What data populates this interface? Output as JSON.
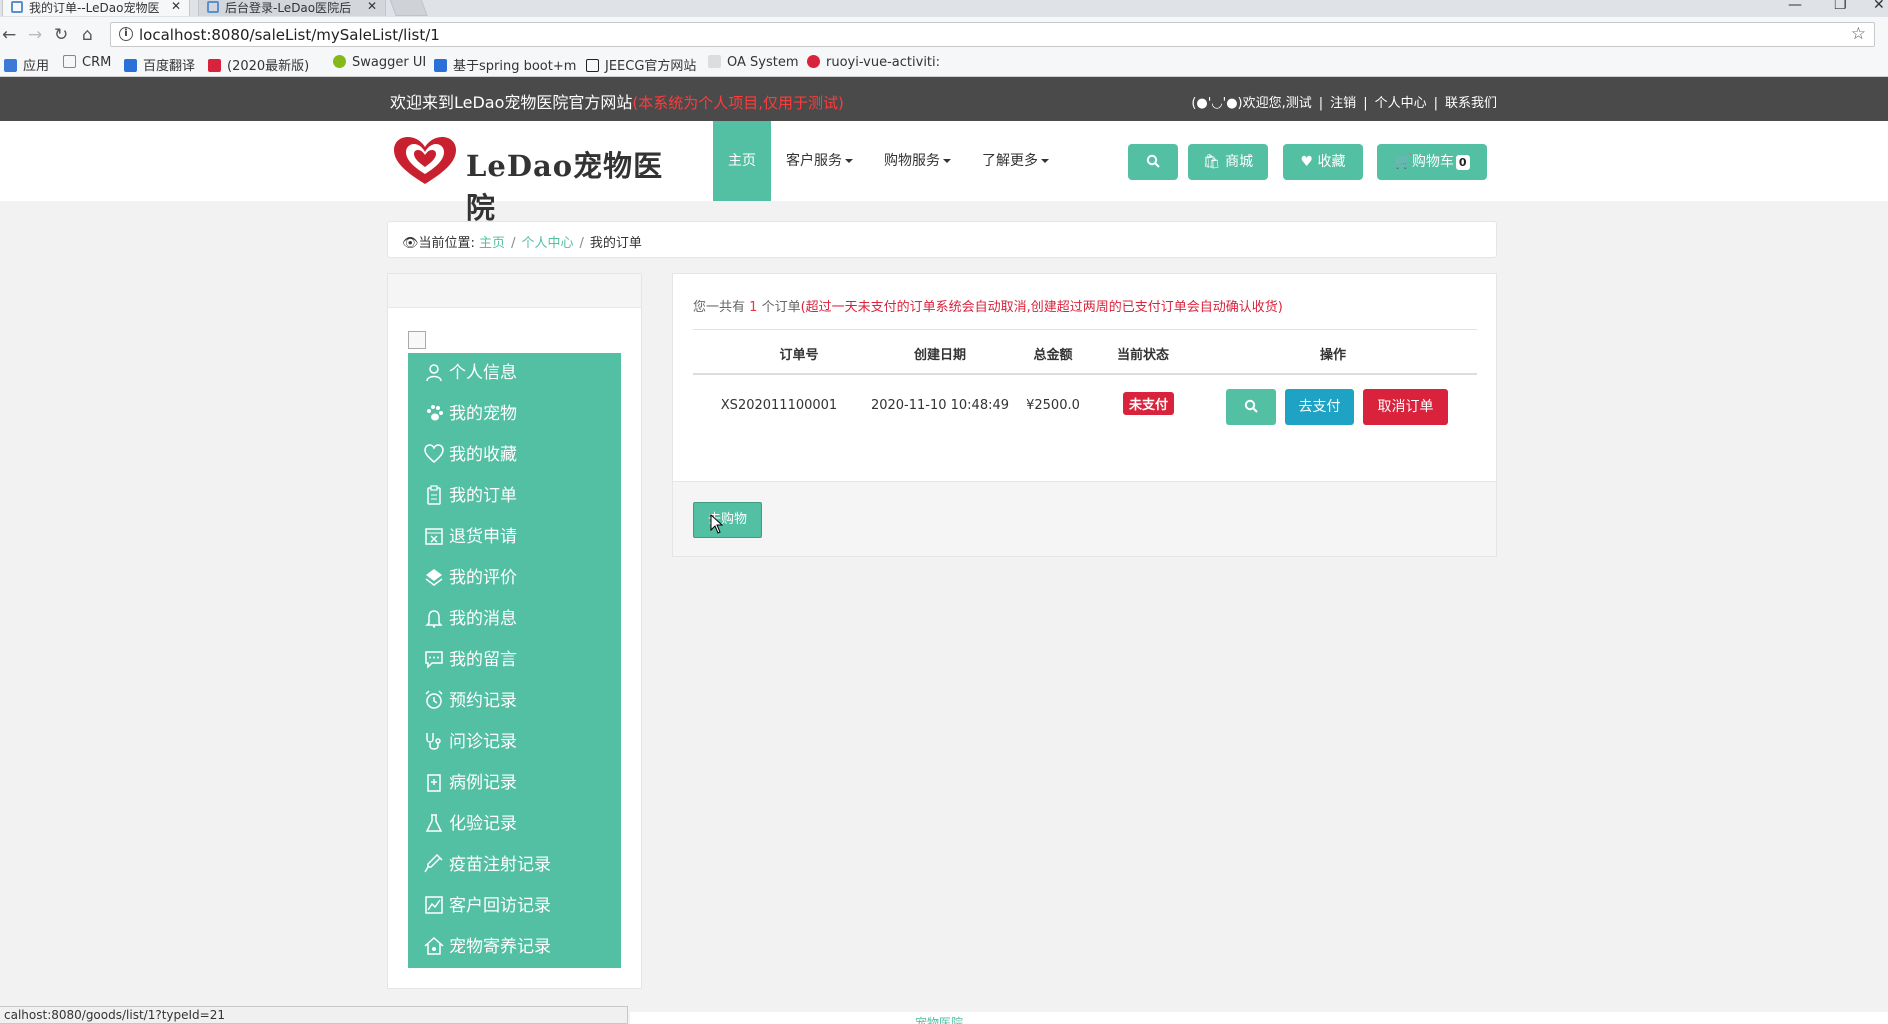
{
  "browser": {
    "tabs": [
      {
        "title": "我的订单--LeDao宠物医"
      },
      {
        "title": "后台登录-LeDao医院后"
      }
    ],
    "url": "localhost:8080/saleList/mySaleList/list/1",
    "bookmarks": [
      {
        "label": "应用",
        "icon": "apps-icon",
        "color": "#3c78d8"
      },
      {
        "label": "CRM",
        "icon": "page-icon",
        "color": "#888888"
      },
      {
        "label": "百度翻译",
        "icon": "baidu-translate-icon",
        "color": "#2b6fd9"
      },
      {
        "label": "(2020最新版)",
        "icon": "csdn-icon",
        "color": "#d9233c"
      },
      {
        "label": "Swagger UI",
        "icon": "swagger-icon",
        "color": "#85b81b"
      },
      {
        "label": "基于spring boot+m",
        "icon": "doc-icon",
        "color": "#2b6fd9"
      },
      {
        "label": "JEECG官方网站",
        "icon": "jeecg-icon",
        "color": "#222222"
      },
      {
        "label": "OA System",
        "icon": "oa-icon",
        "color": "#bbbbbb"
      },
      {
        "label": "ruoyi-vue-activiti: ",
        "icon": "gitee-icon",
        "color": "#d9233c"
      }
    ],
    "status_url": "calhost:8080/goods/list/1?typeId=21"
  },
  "site": {
    "welcome": "欢迎来到LeDao宠物医院官方网站",
    "welcome_note": "(本系统为个人项目,仅用于测试)",
    "top_links": {
      "greeting": "(●'◡'●)欢迎您,测试",
      "logout": "注销",
      "user_center": "个人中心",
      "contact": "联系我们"
    },
    "logo_text": "LeDao宠物医院",
    "nav": {
      "home": "主页",
      "customer": "客户服务",
      "shopping": "购物服务",
      "more": "了解更多"
    },
    "buttons": {
      "mall": "商城",
      "favorite": "收藏",
      "cart": "购物车",
      "cart_count": "0"
    },
    "brand_color": "#53bfa3",
    "danger_color": "#d9233c",
    "info_color": "#1ea3c4"
  },
  "breadcrumb": {
    "prefix": "当前位置:",
    "home": "主页",
    "user_center": "个人中心",
    "current": "我的订单"
  },
  "sidebar": {
    "items": [
      {
        "label": "个人信息",
        "icon": "user-icon"
      },
      {
        "label": "我的宠物",
        "icon": "paw-icon"
      },
      {
        "label": "我的收藏",
        "icon": "heart-icon"
      },
      {
        "label": "我的订单",
        "icon": "clipboard-icon"
      },
      {
        "label": "退货申请",
        "icon": "return-box-icon"
      },
      {
        "label": "我的评价",
        "icon": "review-icon"
      },
      {
        "label": "我的消息",
        "icon": "bell-icon"
      },
      {
        "label": "我的留言",
        "icon": "chat-icon"
      },
      {
        "label": "预约记录",
        "icon": "alarm-clock-icon"
      },
      {
        "label": "问诊记录",
        "icon": "stethoscope-icon"
      },
      {
        "label": "病例记录",
        "icon": "medical-record-icon"
      },
      {
        "label": "化验记录",
        "icon": "flask-icon"
      },
      {
        "label": "疫苗注射记录",
        "icon": "syringe-icon"
      },
      {
        "label": "客户回访记录",
        "icon": "chart-icon"
      },
      {
        "label": "宠物寄养记录",
        "icon": "house-icon"
      }
    ]
  },
  "orders": {
    "summary_prefix": "您一共有",
    "summary_count": "1",
    "summary_suffix": "个订单",
    "summary_note": "(超过一天未支付的订单系统会自动取消,创建超过两周的已支付订单会自动确认收货)",
    "columns": {
      "order_no": "订单号",
      "created": "创建日期",
      "total": "总金额",
      "status": "当前状态",
      "actions": "操作"
    },
    "rows": [
      {
        "order_no": "XS202011100001",
        "created": "2020-11-10 10:48:49",
        "total": "¥2500.0",
        "status": "未支付",
        "pay_label": "去支付",
        "cancel_label": "取消订单"
      }
    ],
    "shop_button": "去购物"
  },
  "footer_hint": "宠物医院"
}
